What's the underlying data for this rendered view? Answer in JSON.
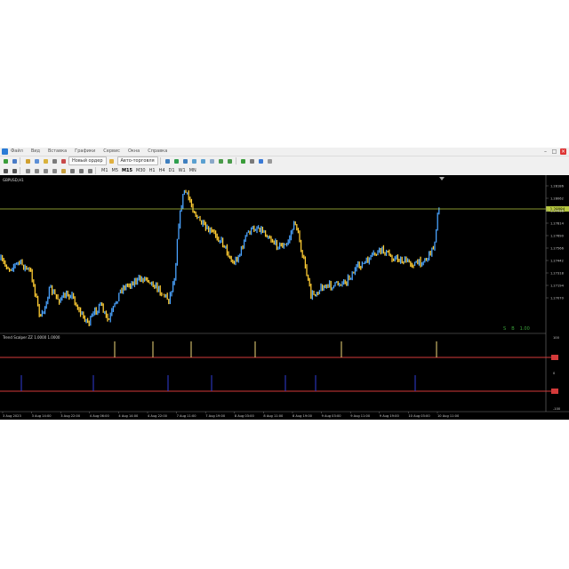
{
  "menu": {
    "items": [
      "Файл",
      "Вид",
      "Вставка",
      "Графики",
      "Сервис",
      "Окна",
      "Справка"
    ],
    "window_controls": [
      "–",
      "□",
      "×"
    ]
  },
  "toolbar": {
    "new_order": "Новый ордер",
    "auto_trading": "Авто-торговля",
    "timeframes": [
      "M1",
      "M5",
      "M15",
      "M30",
      "H1",
      "H4",
      "D1",
      "W1",
      "MN"
    ],
    "active_timeframe": "M15"
  },
  "chart": {
    "symbol_label": "GBPUSD,H1",
    "current_price_label": "1.28084",
    "price_axis": [
      "1.28186",
      "1.28062",
      "1.27938",
      "1.27814",
      "1.27690",
      "1.27566",
      "1.27442",
      "1.27318",
      "1.27194",
      "1.27070"
    ],
    "trade_panel": [
      "S",
      "B",
      "1.00"
    ],
    "indicator_label": "Trend Scalper  ZZ  1.0000  1.0000",
    "indicator_axis": [
      "100",
      "0",
      "-100"
    ],
    "time_axis": [
      "3 Aug 2023",
      "3 Aug 14:00",
      "3 Aug 22:00",
      "4 Aug 06:00",
      "4 Aug 14:00",
      "4 Aug 22:00",
      "7 Aug 11:00",
      "7 Aug 19:00",
      "8 Aug 03:00",
      "8 Aug 11:00",
      "8 Aug 19:00",
      "9 Aug 03:00",
      "9 Aug 11:00",
      "9 Aug 19:00",
      "10 Aug 03:00",
      "10 Aug 11:00"
    ],
    "colors": {
      "background": "#000000",
      "candle_up": "#4aa3ff",
      "candle_down": "#ffcc33",
      "price_line": "#b7c840",
      "indicator_red": "#d43a3a",
      "signal_up": "#f0d87a",
      "signal_down": "#2f3dd6"
    }
  }
}
